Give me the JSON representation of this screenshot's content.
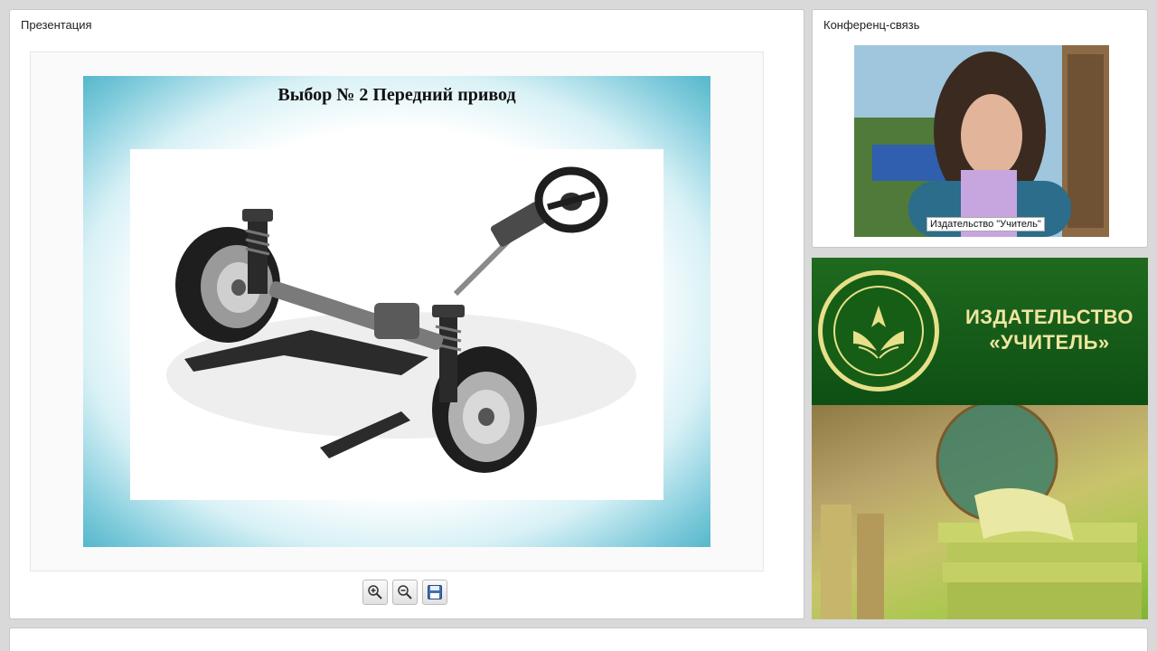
{
  "presentation": {
    "title": "Презентация",
    "slide_title": "Выбор № 2 Передний привод",
    "toolbar": {
      "zoom_in_icon": "zoom-in-icon",
      "zoom_out_icon": "zoom-out-icon",
      "save_icon": "save-icon"
    }
  },
  "conference": {
    "title": "Конференц-связь",
    "caption": "Издательство \"Учитель\""
  },
  "banner": {
    "line1": "ИЗДАТЕЛЬСТВО",
    "line2": "«УЧИТЕЛЬ»"
  },
  "colors": {
    "slide_border": "#56b7cb",
    "banner_green": "#165e16",
    "banner_text": "#efe6a0"
  }
}
